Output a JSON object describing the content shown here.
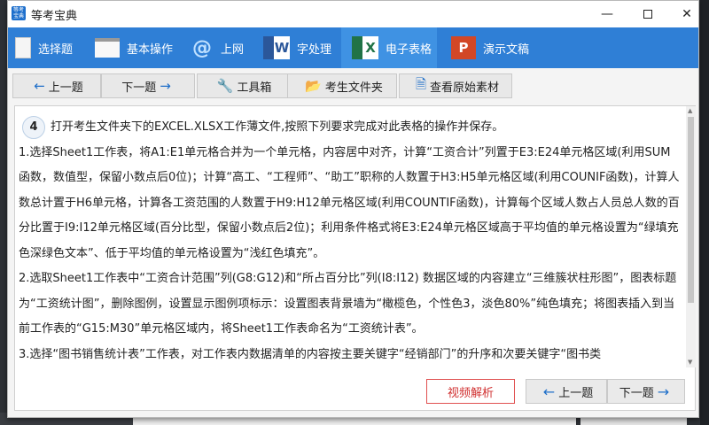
{
  "window": {
    "title": "等考宝典",
    "logo_text": "等考宝典"
  },
  "nav": {
    "items": [
      {
        "label": "选择题",
        "icon": "document-icon"
      },
      {
        "label": "基本操作",
        "icon": "window-icon"
      },
      {
        "label": "上网",
        "icon": "at-icon",
        "glyph": "@"
      },
      {
        "label": "字处理",
        "icon": "word-icon",
        "glyph": "W"
      },
      {
        "label": "电子表格",
        "icon": "excel-icon",
        "glyph": "X",
        "active": true
      },
      {
        "label": "演示文稿",
        "icon": "powerpoint-icon",
        "glyph": "P"
      }
    ]
  },
  "toolbar": {
    "prev_label": "上一题",
    "next_label": "下一题",
    "tools_label": "工具箱",
    "folder_label": "考生文件夹",
    "source_label": "查看原始素材"
  },
  "question": {
    "number": "4",
    "intro": "打开考生文件夹下的EXCEL.XLSX工作薄文件,按照下列要求完成对此表格的操作并保存。",
    "para1": "1.选择Sheet1工作表，将A1:E1单元格合并为一个单元格，内容居中对齐，计算“工资合计”列置于E3:E24单元格区域(利用SUM函数，数值型，保留小数点后0位)；计算“高工、“工程师”、“助工”职称的人数置于H3:H5单元格区域(利用COUNIF函数)，计算人数总计置于H6单元格，计算各工资范围的人数置于H9:H12单元格区域(利用COUNTIF函数)，计算每个区域人数占人员总人数的百分比置于I9:I12单元格区域(百分比型，保留小数点后2位)；利用条件格式将E3:E24单元格区域高于平均值的单元格设置为“绿填充色深绿色文本”、低于平均值的单元格设置为“浅红色填充”。",
    "para2": "2.选取Sheet1工作表中“工资合计范围”列(G8:G12)和“所占百分比”列(I8:I12) 数据区域的内容建立“三维簇状柱形图”，图表标题为“工资统计图”，删除图例，设置显示图例项标示：设置图表背景墙为“橄榄色，个性色3，淡色80%”纯色填充；将图表插入到当前工作表的“G15:M30”单元格区域内，将Sheet1工作表命名为“工资统计表”。",
    "para3": "3.选择“图书销售统计表”工作表，对工作表内数据清单的内容按主要关键字“经销部门”的升序和次要关键字“图书类"
  },
  "bottom": {
    "video_label": "视频解析",
    "prev_label": "上一题",
    "next_label": "下一题"
  },
  "colors": {
    "nav_bg": "#2f7fd6",
    "nav_active": "#3f92e3",
    "video_border": "#e05050",
    "arrow": "#1f6fc9"
  }
}
